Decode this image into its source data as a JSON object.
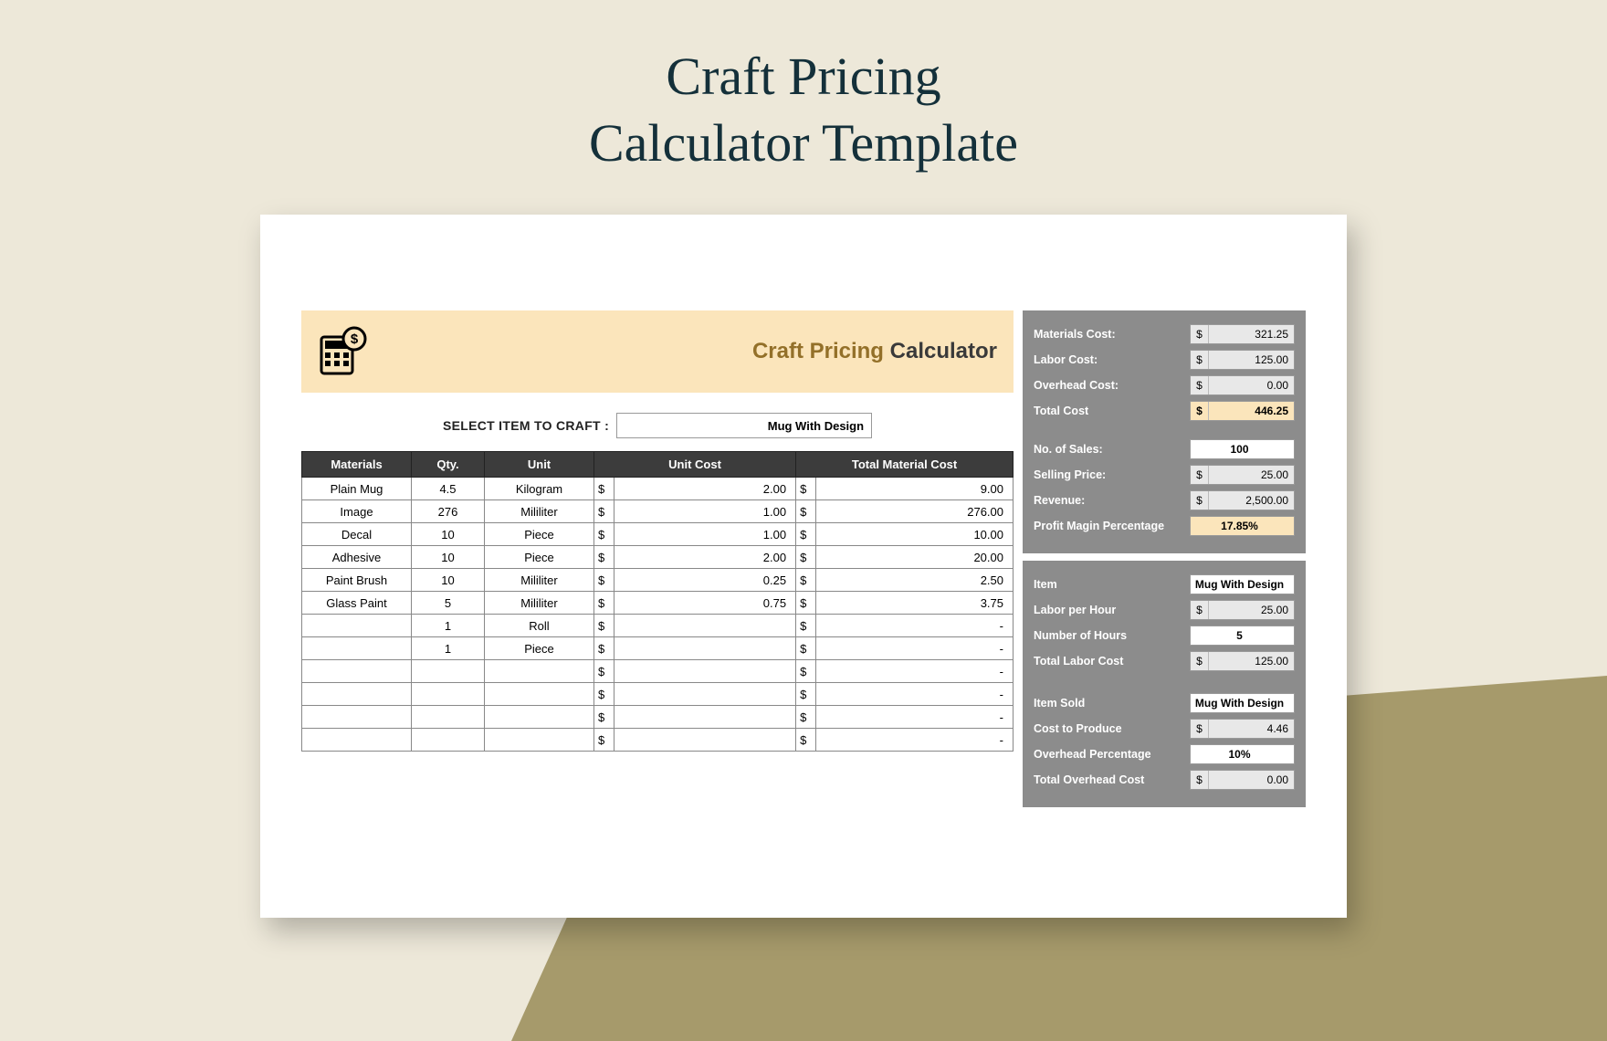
{
  "title_line1": "Craft Pricing",
  "title_line2": "Calculator Template",
  "banner": {
    "accent": "Craft Pricing",
    "plain": " Calculator"
  },
  "select": {
    "label": "SELECT ITEM TO CRAFT   :",
    "value": "Mug With Design"
  },
  "table": {
    "headers": [
      "Materials",
      "Qty.",
      "Unit",
      "Unit Cost",
      "Total Material Cost"
    ],
    "rows": [
      {
        "mat": "Plain Mug",
        "qty": "4.5",
        "unit": "Kilogram",
        "uc": "2.00",
        "tot": "9.00"
      },
      {
        "mat": "Image",
        "qty": "276",
        "unit": "Mililiter",
        "uc": "1.00",
        "tot": "276.00"
      },
      {
        "mat": "Decal",
        "qty": "10",
        "unit": "Piece",
        "uc": "1.00",
        "tot": "10.00"
      },
      {
        "mat": "Adhesive",
        "qty": "10",
        "unit": "Piece",
        "uc": "2.00",
        "tot": "20.00"
      },
      {
        "mat": "Paint Brush",
        "qty": "10",
        "unit": "Mililiter",
        "uc": "0.25",
        "tot": "2.50"
      },
      {
        "mat": "Glass Paint",
        "qty": "5",
        "unit": "Mililiter",
        "uc": "0.75",
        "tot": "3.75"
      },
      {
        "mat": "",
        "qty": "1",
        "unit": "Roll",
        "uc": "",
        "tot": "-"
      },
      {
        "mat": "",
        "qty": "1",
        "unit": "Piece",
        "uc": "",
        "tot": "-"
      },
      {
        "mat": "",
        "qty": "",
        "unit": "",
        "uc": "",
        "tot": "-"
      },
      {
        "mat": "",
        "qty": "",
        "unit": "",
        "uc": "",
        "tot": "-"
      },
      {
        "mat": "",
        "qty": "",
        "unit": "",
        "uc": "",
        "tot": "-"
      },
      {
        "mat": "",
        "qty": "",
        "unit": "",
        "uc": "",
        "tot": "-"
      }
    ]
  },
  "summary": {
    "materials_cost": {
      "label": "Materials Cost:",
      "cur": "$",
      "val": "321.25"
    },
    "labor_cost": {
      "label": "Labor Cost:",
      "cur": "$",
      "val": "125.00"
    },
    "overhead_cost": {
      "label": "Overhead Cost:",
      "cur": "$",
      "val": "0.00"
    },
    "total_cost": {
      "label": "Total Cost",
      "cur": "$",
      "val": "446.25"
    },
    "no_sales": {
      "label": "No. of Sales:",
      "val": "100"
    },
    "selling_price": {
      "label": "Selling Price:",
      "cur": "$",
      "val": "25.00"
    },
    "revenue": {
      "label": "Revenue:",
      "cur": "$",
      "val": "2,500.00"
    },
    "profit_margin": {
      "label": "Profit Magin Percentage",
      "val": "17.85%"
    }
  },
  "labor": {
    "item": {
      "label": "Item",
      "val": "Mug With Design"
    },
    "per_hour": {
      "label": "Labor per Hour",
      "cur": "$",
      "val": "25.00"
    },
    "hours": {
      "label": "Number of Hours",
      "val": "5"
    },
    "total": {
      "label": "Total Labor Cost",
      "cur": "$",
      "val": "125.00"
    }
  },
  "overhead": {
    "item_sold": {
      "label": "Item Sold",
      "val": "Mug With Design"
    },
    "cost_produce": {
      "label": "Cost to Produce",
      "cur": "$",
      "val": "4.46"
    },
    "pct": {
      "label": "Overhead Percentage",
      "val": "10%"
    },
    "total": {
      "label": "Total Overhead Cost",
      "cur": "$",
      "val": "0.00"
    }
  }
}
